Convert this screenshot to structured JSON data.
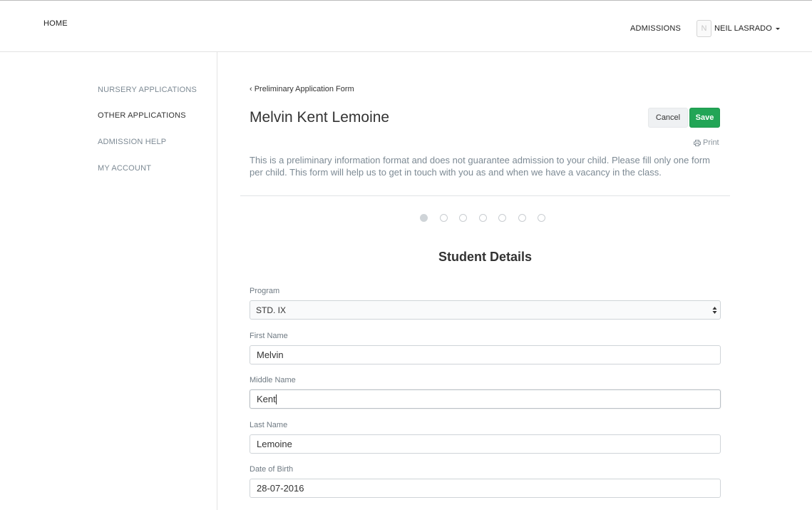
{
  "topnav": {
    "home": "HOME",
    "admissions": "ADMISSIONS",
    "user": {
      "initial": "N",
      "name": "NEIL LASRADO"
    }
  },
  "sidebar": {
    "items": [
      {
        "label": "NURSERY APPLICATIONS"
      },
      {
        "label": "OTHER APPLICATIONS"
      },
      {
        "label": "ADMISSION HELP"
      },
      {
        "label": "MY ACCOUNT"
      }
    ],
    "active_index": 1
  },
  "main": {
    "back_link": "‹ Preliminary Application Form",
    "title": "Melvin Kent Lemoine",
    "cancel_label": "Cancel",
    "save_label": "Save",
    "print_label": "Print",
    "intro": "This is a preliminary information format and does not guarantee admission to your child. Please fill only one form per child. This form will help us to get in touch with you as and when we have a vacancy in the class.",
    "steps_total": 7,
    "steps_current": 1,
    "section_title": "Student Details",
    "fields": {
      "program": {
        "label": "Program",
        "value": "STD. IX"
      },
      "first_name": {
        "label": "First Name",
        "value": "Melvin"
      },
      "middle_name": {
        "label": "Middle Name",
        "value": "Kent"
      },
      "last_name": {
        "label": "Last Name",
        "value": "Lemoine"
      },
      "dob": {
        "label": "Date of Birth",
        "value": "28-07-2016"
      }
    }
  },
  "colors": {
    "save_green": "#22a556",
    "muted_text": "#7d8a94",
    "border": "#cfd4d8"
  }
}
